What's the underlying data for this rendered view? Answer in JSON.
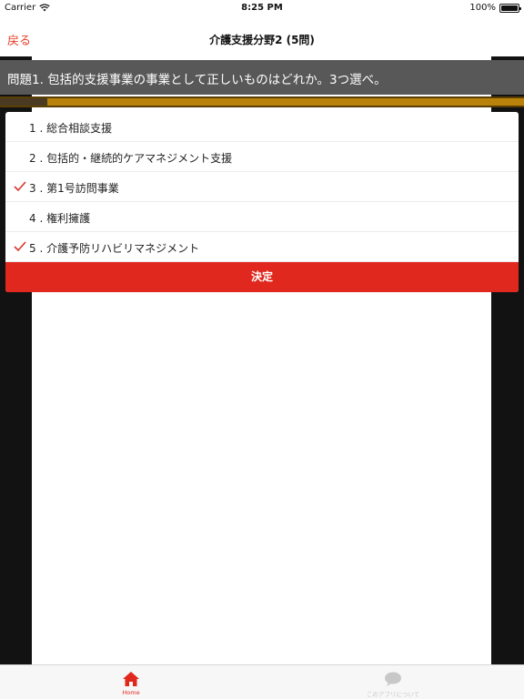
{
  "status_bar": {
    "carrier": "Carrier",
    "time": "8:25 PM",
    "battery": "100%"
  },
  "nav": {
    "back_label": "戻る",
    "title": "介護支援分野2 (5問)"
  },
  "question": {
    "text": "問題1. 包括的支援事業の事業として正しいものはどれか。3つ選べ。"
  },
  "progress": {
    "fraction": 0.09
  },
  "choices": [
    {
      "label": "1 . 総合相談支援",
      "checked": false
    },
    {
      "label": "2 . 包括的・継続的ケアマネジメント支援",
      "checked": false
    },
    {
      "label": "3 . 第1号訪問事業",
      "checked": true
    },
    {
      "label": "4 . 権利擁護",
      "checked": false
    },
    {
      "label": "5 . 介護予防リハビリマネジメント",
      "checked": true
    }
  ],
  "submit_label": "決定",
  "tabs": [
    {
      "label": "Home",
      "icon": "home-icon",
      "active": true
    },
    {
      "label": "このアプリについて",
      "icon": "speech-bubble-icon",
      "active": false
    }
  ],
  "colors": {
    "accent": "#e0281e",
    "check": "#d9342b",
    "progress": "#b8820b",
    "inactive_tab": "#c8c8c8"
  }
}
